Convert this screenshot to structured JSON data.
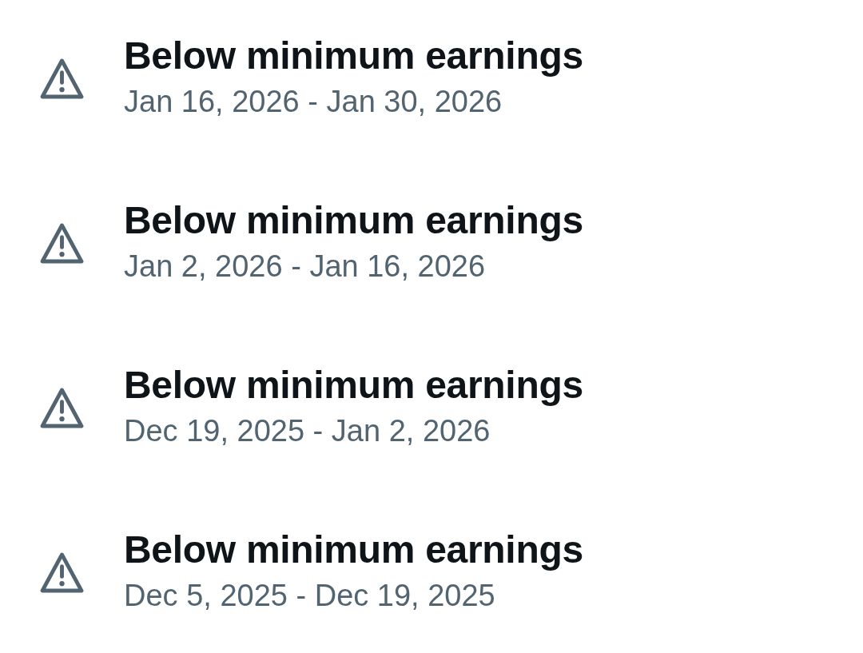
{
  "items": [
    {
      "title": "Below minimum earnings",
      "date_range": "Jan 16, 2026 - Jan 30, 2026"
    },
    {
      "title": "Below minimum earnings",
      "date_range": "Jan 2, 2026 - Jan 16, 2026"
    },
    {
      "title": "Below minimum earnings",
      "date_range": "Dec 19, 2025 - Jan 2, 2026"
    },
    {
      "title": "Below minimum earnings",
      "date_range": "Dec 5, 2025 - Dec 19, 2025"
    }
  ]
}
